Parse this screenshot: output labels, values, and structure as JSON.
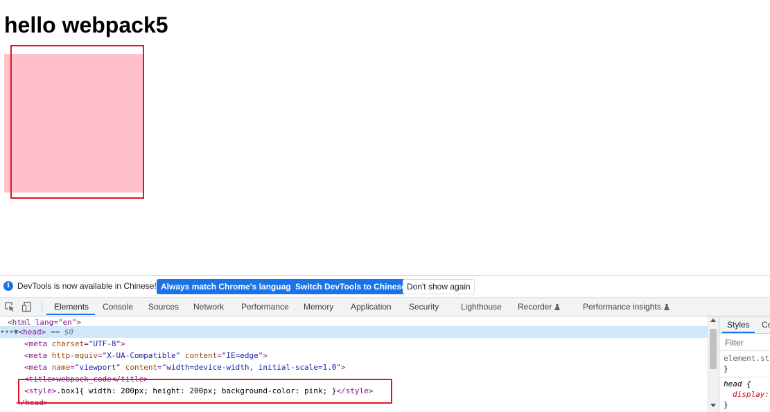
{
  "page": {
    "heading": "hello webpack5",
    "box_color": "#ffc0cb"
  },
  "annotations": {
    "color": "#e8121f"
  },
  "infobar": {
    "message": "DevTools is now available in Chinese!",
    "buttons": {
      "match": "Always match Chrome's language",
      "switch": "Switch DevTools to Chinese",
      "dismiss": "Don't show again"
    }
  },
  "tabs": [
    {
      "label": "Elements",
      "active": true
    },
    {
      "label": "Console"
    },
    {
      "label": "Sources"
    },
    {
      "label": "Network"
    },
    {
      "label": "Performance"
    },
    {
      "label": "Memory"
    },
    {
      "label": "Application"
    },
    {
      "label": "Security"
    },
    {
      "label": "Lighthouse"
    },
    {
      "label": "Recorder",
      "icon": "flask-icon"
    },
    {
      "label": "Performance insights",
      "icon": "flask-icon"
    }
  ],
  "dom": {
    "html_tag": "<html lang=\"en\">",
    "head_open": "<head>",
    "head_eq": "== $0",
    "meta_charset": {
      "name": "charset",
      "value": "\"UTF-8\""
    },
    "meta_http": {
      "name1": "http-equiv",
      "value1": "\"X-UA-Compatible\"",
      "name2": "content",
      "value2": "\"IE=edge\""
    },
    "meta_viewport": {
      "name1": "name",
      "value1": "\"viewport\"",
      "name2": "content",
      "value2": "\"width=device-width, initial-scale=1.0\""
    },
    "title_line": "<title>webpack_code</title>",
    "style_open": "<style>",
    "style_text": ".box1{ width: 200px; height: 200px; background-color: pink; }",
    "style_close": "</style>",
    "head_close": "</head>"
  },
  "styles_pane": {
    "tab_styles": "Styles",
    "tab_computed": "Co",
    "filter_placeholder": "Filter",
    "element_style": "element.sty",
    "brace_close": "}",
    "head_selector": "head {",
    "display_prop": "display:"
  }
}
